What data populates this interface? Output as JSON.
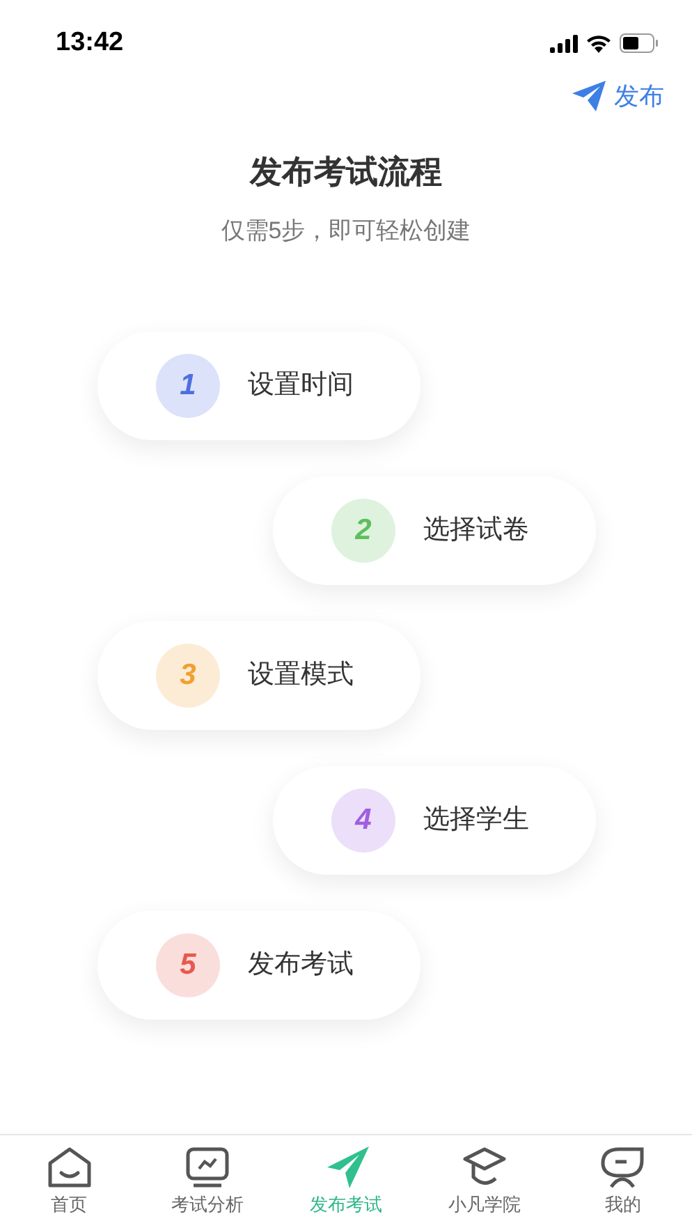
{
  "status_bar": {
    "time": "13:42"
  },
  "header": {
    "action": "发布"
  },
  "intro": {
    "title": "发布考试流程",
    "subtitle": "仅需5步，即可轻松创建"
  },
  "steps": [
    {
      "number": "1",
      "label": "设置时间",
      "color": "#4f6fe0"
    },
    {
      "number": "2",
      "label": "选择试卷",
      "color": "#5cbf5c"
    },
    {
      "number": "3",
      "label": "设置模式",
      "color": "#f0a030"
    },
    {
      "number": "4",
      "label": "选择学生",
      "color": "#a05ee0"
    },
    {
      "number": "5",
      "label": "发布考试",
      "color": "#e8584e"
    }
  ],
  "tab_bar": [
    {
      "label": "首页",
      "selected": false
    },
    {
      "label": "考试分析",
      "selected": false
    },
    {
      "label": "发布考试",
      "selected": true
    },
    {
      "label": "小凡学院",
      "selected": false
    },
    {
      "label": "我的",
      "selected": false
    }
  ]
}
